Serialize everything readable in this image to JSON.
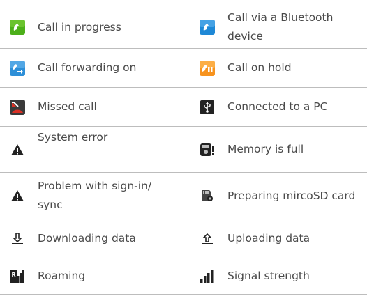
{
  "table": {
    "rows": [
      {
        "left": {
          "icon": "call-in-progress-icon",
          "label": "Call in progress"
        },
        "right": {
          "icon": "bluetooth-call-icon",
          "label": "Call via a Bluetooth device"
        }
      },
      {
        "left": {
          "icon": "call-forwarding-icon",
          "label": "Call forwarding on"
        },
        "right": {
          "icon": "call-on-hold-icon",
          "label": "Call on hold"
        }
      },
      {
        "left": {
          "icon": "missed-call-icon",
          "label": "Missed call"
        },
        "right": {
          "icon": "usb-connected-icon",
          "label": "Connected to a PC"
        }
      },
      {
        "left": {
          "icon": "system-error-icon",
          "label": "System error"
        },
        "right": {
          "icon": "memory-full-icon",
          "label": "Memory is full"
        }
      },
      {
        "left": {
          "icon": "sync-problem-icon",
          "label": "Problem with sign-in/ sync"
        },
        "right": {
          "icon": "preparing-sd-card-icon",
          "label": "Preparing mircoSD card"
        }
      },
      {
        "left": {
          "icon": "download-icon",
          "label": "Downloading data"
        },
        "right": {
          "icon": "upload-icon",
          "label": "Uploading data"
        }
      },
      {
        "left": {
          "icon": "roaming-icon",
          "label": "Roaming"
        },
        "right": {
          "icon": "signal-strength-icon",
          "label": "Signal strength"
        }
      }
    ]
  },
  "colors": {
    "call_green": "#4caf1a",
    "bluetooth_blue": "#1e88d6",
    "forward_blue": "#2d8fd8",
    "hold_orange": "#f7931e",
    "missed_red": "#d93025",
    "icon_dark": "#222222"
  }
}
